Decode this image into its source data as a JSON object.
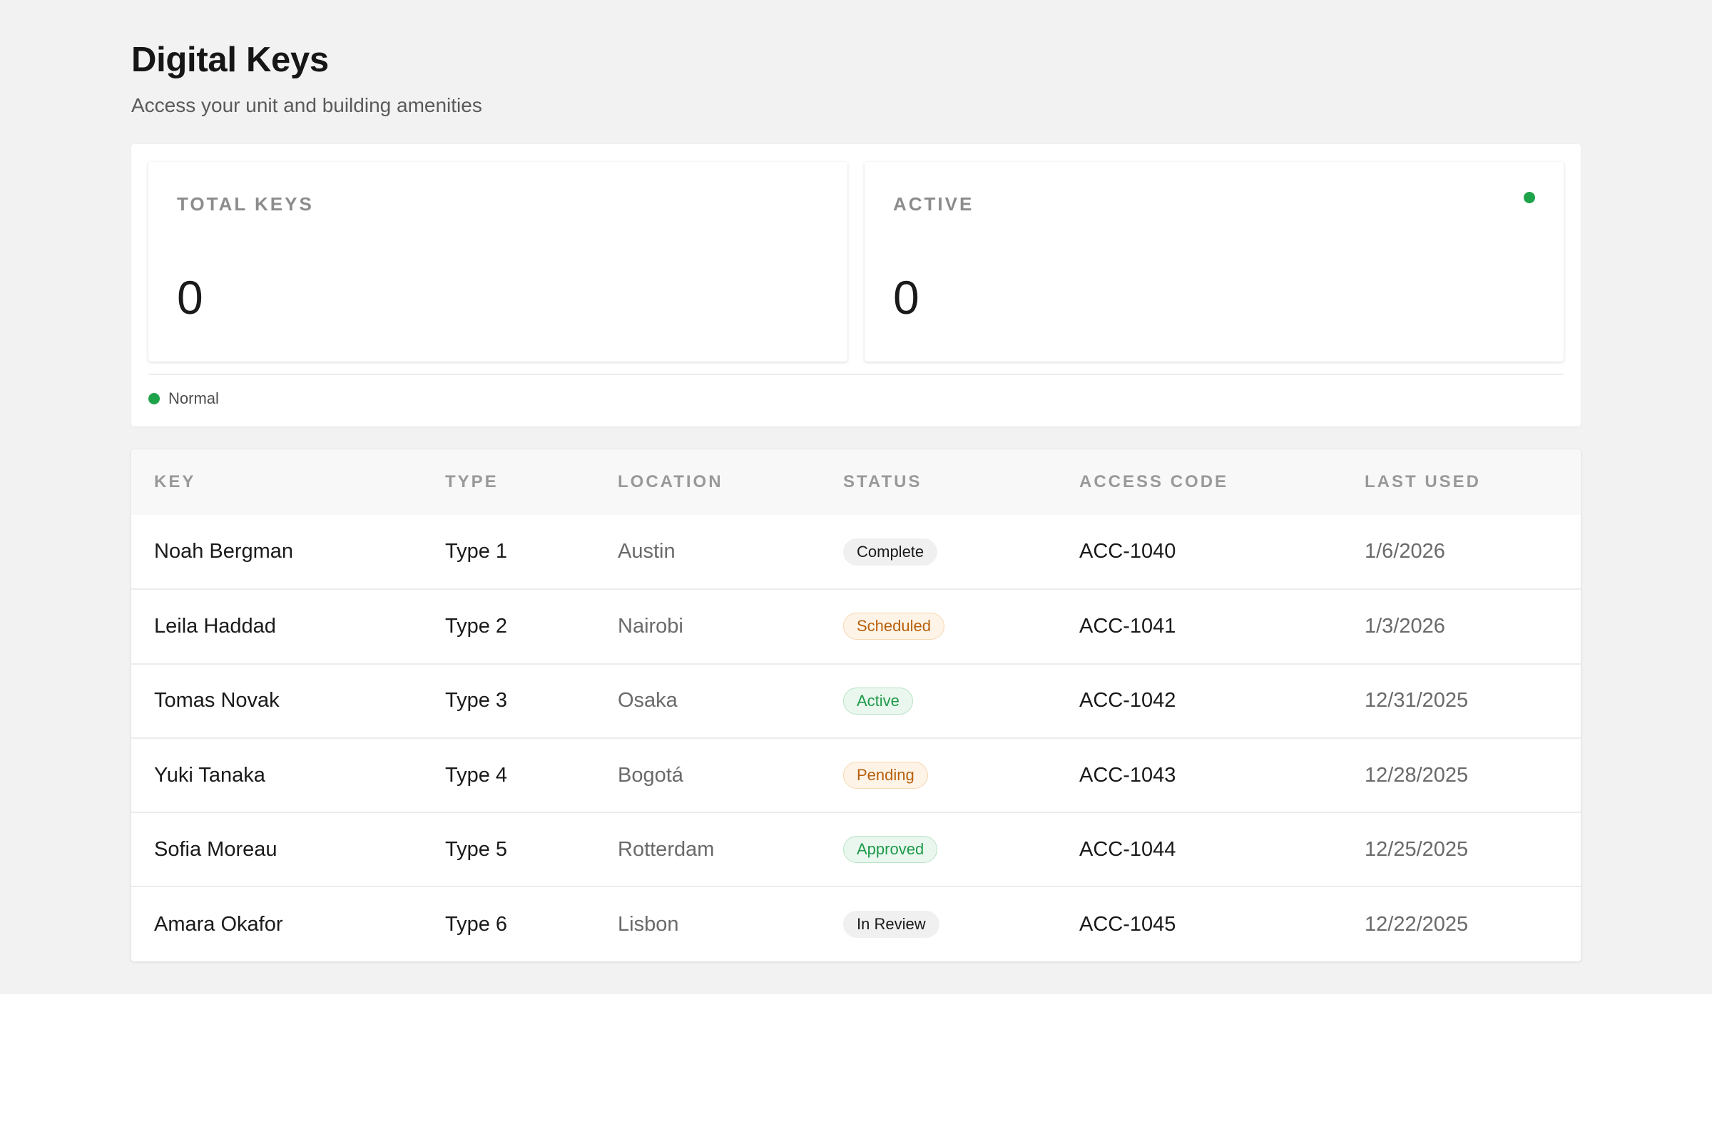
{
  "header": {
    "title": "Digital Keys",
    "subtitle": "Access your unit and building amenities"
  },
  "stats": {
    "total_keys": {
      "label": "TOTAL KEYS",
      "value": "0"
    },
    "active": {
      "label": "ACTIVE",
      "value": "0",
      "indicator_color": "#1fa34a"
    },
    "legend": {
      "label": "Normal",
      "color": "#1fa34a"
    }
  },
  "table": {
    "columns": [
      "KEY",
      "TYPE",
      "LOCATION",
      "STATUS",
      "ACCESS CODE",
      "LAST USED"
    ],
    "rows": [
      {
        "key": "Noah Bergman",
        "type": "Type 1",
        "location": "Austin",
        "status": "Complete",
        "status_style": "neutral",
        "access_code": "ACC-1040",
        "last_used": "1/6/2026"
      },
      {
        "key": "Leila Haddad",
        "type": "Type 2",
        "location": "Nairobi",
        "status": "Scheduled",
        "status_style": "orange",
        "access_code": "ACC-1041",
        "last_used": "1/3/2026"
      },
      {
        "key": "Tomas Novak",
        "type": "Type 3",
        "location": "Osaka",
        "status": "Active",
        "status_style": "green",
        "access_code": "ACC-1042",
        "last_used": "12/31/2025"
      },
      {
        "key": "Yuki Tanaka",
        "type": "Type 4",
        "location": "Bogotá",
        "status": "Pending",
        "status_style": "orange",
        "access_code": "ACC-1043",
        "last_used": "12/28/2025"
      },
      {
        "key": "Sofia Moreau",
        "type": "Type 5",
        "location": "Rotterdam",
        "status": "Approved",
        "status_style": "green",
        "access_code": "ACC-1044",
        "last_used": "12/25/2025"
      },
      {
        "key": "Amara Okafor",
        "type": "Type 6",
        "location": "Lisbon",
        "status": "In Review",
        "status_style": "neutral",
        "access_code": "ACC-1045",
        "last_used": "12/22/2025"
      }
    ]
  }
}
